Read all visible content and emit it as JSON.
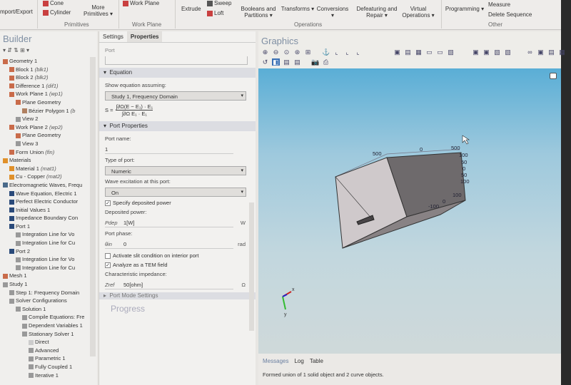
{
  "ribbon": {
    "import_export": "mport/Export",
    "cone": "Cone",
    "cylinder": "Cylinder",
    "more_primitives": "More Primitives ▾",
    "primitives_group": "Primitives",
    "work_plane": "Work Plane",
    "work_plane_group": "Work Plane",
    "extrude": "Extrude",
    "sweep": "Sweep",
    "loft": "Loft",
    "booleans": "Booleans and Partitions ▾",
    "transforms": "Transforms ▾",
    "conversions": "Conversions ▾",
    "defeaturing": "Defeaturing and Repair ▾",
    "virtual_ops": "Virtual Operations ▾",
    "operations_group": "Operations",
    "programming": "Programming ▾",
    "measure": "Measure",
    "delete_sequence": "Delete Sequence",
    "other_group": "Other"
  },
  "builder": {
    "title": "Builder",
    "items": [
      {
        "label": "Geometry 1",
        "tag": "",
        "level": 0,
        "color": "#c96b4a"
      },
      {
        "label": "Block 1",
        "tag": "(blk1)",
        "level": 1,
        "color": "#c96b4a"
      },
      {
        "label": "Block 2",
        "tag": "(blk2)",
        "level": 1,
        "color": "#c96b4a"
      },
      {
        "label": "Difference 1",
        "tag": "(dif1)",
        "level": 1,
        "color": "#c96b4a"
      },
      {
        "label": "Work Plane 1",
        "tag": "(wp1)",
        "level": 1,
        "color": "#c96b4a"
      },
      {
        "label": "Plane Geometry",
        "tag": "",
        "level": 2,
        "color": "#c96b4a"
      },
      {
        "label": "Bézier Polygon 1",
        "tag": "(b",
        "level": 3,
        "color": "#b08060"
      },
      {
        "label": "View 2",
        "tag": "",
        "level": 2,
        "color": "#999"
      },
      {
        "label": "Work Plane 2",
        "tag": "(wp2)",
        "level": 1,
        "color": "#c96b4a"
      },
      {
        "label": "Plane Geometry",
        "tag": "",
        "level": 2,
        "color": "#c96b4a"
      },
      {
        "label": "View 3",
        "tag": "",
        "level": 2,
        "color": "#999"
      },
      {
        "label": "Form Union",
        "tag": "(fin)",
        "level": 1,
        "color": "#c96b4a"
      },
      {
        "label": "Materials",
        "tag": "",
        "level": 0,
        "color": "#e0902a"
      },
      {
        "label": "Material 1",
        "tag": "(mat1)",
        "level": 1,
        "color": "#e0902a"
      },
      {
        "label": "Cu - Copper",
        "tag": "(mat2)",
        "level": 1,
        "color": "#e0902a"
      },
      {
        "label": "Electromagnetic Waves, Frequ",
        "tag": "",
        "level": 0,
        "color": "#4a6a8a"
      },
      {
        "label": "Wave Equation, Electric 1",
        "tag": "",
        "level": 1,
        "color": "#2a4a7a"
      },
      {
        "label": "Perfect Electric Conductor",
        "tag": "",
        "level": 1,
        "color": "#2a4a7a"
      },
      {
        "label": "Initial Values 1",
        "tag": "",
        "level": 1,
        "color": "#2a4a7a"
      },
      {
        "label": "Impedance Boundary Con",
        "tag": "",
        "level": 1,
        "color": "#2a4a7a"
      },
      {
        "label": "Port 1",
        "tag": "",
        "level": 1,
        "color": "#2a4a7a"
      },
      {
        "label": "Integration Line for Vo",
        "tag": "",
        "level": 2,
        "color": "#999"
      },
      {
        "label": "Integration Line for Cu",
        "tag": "",
        "level": 2,
        "color": "#999"
      },
      {
        "label": "Port 2",
        "tag": "",
        "level": 1,
        "color": "#2a4a7a"
      },
      {
        "label": "Integration Line for Vo",
        "tag": "",
        "level": 2,
        "color": "#999"
      },
      {
        "label": "Integration Line for Cu",
        "tag": "",
        "level": 2,
        "color": "#999"
      },
      {
        "label": "Mesh 1",
        "tag": "",
        "level": 0,
        "color": "#c96b4a"
      },
      {
        "label": "Study 1",
        "tag": "",
        "level": 0,
        "color": "#999"
      },
      {
        "label": "Step 1: Frequency Domain",
        "tag": "",
        "level": 1,
        "color": "#999"
      },
      {
        "label": "Solver Configurations",
        "tag": "",
        "level": 1,
        "color": "#999"
      },
      {
        "label": "Solution 1",
        "tag": "",
        "level": 2,
        "color": "#999"
      },
      {
        "label": "Compile Equations: Fre",
        "tag": "",
        "level": 3,
        "color": "#999"
      },
      {
        "label": "Dependent Variables 1",
        "tag": "",
        "level": 3,
        "color": "#999"
      },
      {
        "label": "Stationary Solver 1",
        "tag": "",
        "level": 3,
        "color": "#999"
      },
      {
        "label": "Direct",
        "tag": "",
        "level": 4,
        "color": "#ccc"
      },
      {
        "label": "Advanced",
        "tag": "",
        "level": 4,
        "color": "#999"
      },
      {
        "label": "Parametric 1",
        "tag": "",
        "level": 4,
        "color": "#999"
      },
      {
        "label": "Fully Coupled 1",
        "tag": "",
        "level": 4,
        "color": "#999"
      },
      {
        "label": "Iterative 1",
        "tag": "",
        "level": 4,
        "color": "#999"
      }
    ]
  },
  "settings": {
    "tab_settings": "Settings",
    "tab_properties": "Properties",
    "node": "Port",
    "equation_section": "Equation",
    "show_eq_label": "Show equation assuming:",
    "show_eq_value": "Study 1, Frequency Domain",
    "equation_lhs": "S =",
    "equation_num": "∫∂Ω(E − E₁) · E₁",
    "equation_den": "∫∂Ω E₁ · E₁",
    "port_props_section": "Port Properties",
    "port_name_label": "Port name:",
    "port_name_value": "1",
    "type_label": "Type of port:",
    "type_value": "Numeric",
    "wave_label": "Wave excitation at this port:",
    "wave_value": "On",
    "specify_power": "Specify deposited power",
    "dep_power_label": "Deposited power:",
    "p_sym": "Pdep",
    "p_value": "1[W]",
    "p_unit": "W",
    "phase_label": "Port phase:",
    "theta_sym": "θin",
    "theta_value": "0",
    "theta_unit": "rad",
    "slit": "Activate slit condition on interior port",
    "tem": "Analyze as a TEM field",
    "imp_label": "Characteristic impedance:",
    "z_sym": "Zref",
    "z_value": "50[ohm]",
    "z_unit": "Ω",
    "mode_section": "Port Mode Settings",
    "progress": "Progress"
  },
  "graphics": {
    "title": "Graphics",
    "axis_labels": [
      "500",
      "0",
      "500",
      "100",
      "50",
      "0",
      "50",
      "100",
      "100",
      "0",
      "-100"
    ],
    "triad_x": "x",
    "triad_y": "y"
  },
  "messages": {
    "tabs": [
      "Messages",
      "Log",
      "Table"
    ],
    "text": "Formed union of 1 solid object and 2 curve objects."
  }
}
